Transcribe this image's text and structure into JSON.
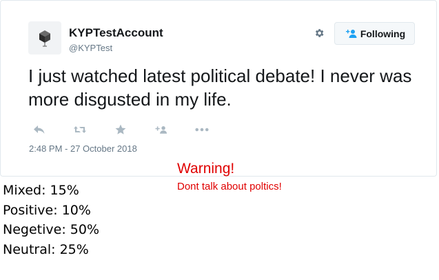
{
  "tweet": {
    "display_name": "KYPTestAccount",
    "handle": "@KYPTest",
    "follow_label": "Following",
    "text": "I just watched latest political debate! I never was more disgusted in my life.",
    "timestamp": "2:48 PM - 27 October 2018",
    "action_icons": [
      "reply-icon",
      "retweet-icon",
      "like-icon",
      "add-to-list-icon",
      "more-icon"
    ]
  },
  "warning": {
    "title": "Warning!",
    "message": "Dont talk about poltics!"
  },
  "sentiment": [
    {
      "label": "Mixed",
      "value": "15%"
    },
    {
      "label": "Positive",
      "value": "10%"
    },
    {
      "label": "Negetive",
      "value": "50%"
    },
    {
      "label": "Neutral",
      "value": "25%"
    }
  ],
  "colors": {
    "warning": "#e00000",
    "secondary_text": "#657786",
    "action_icon": "#aab8c2",
    "follow_accent": "#1da1f2"
  }
}
